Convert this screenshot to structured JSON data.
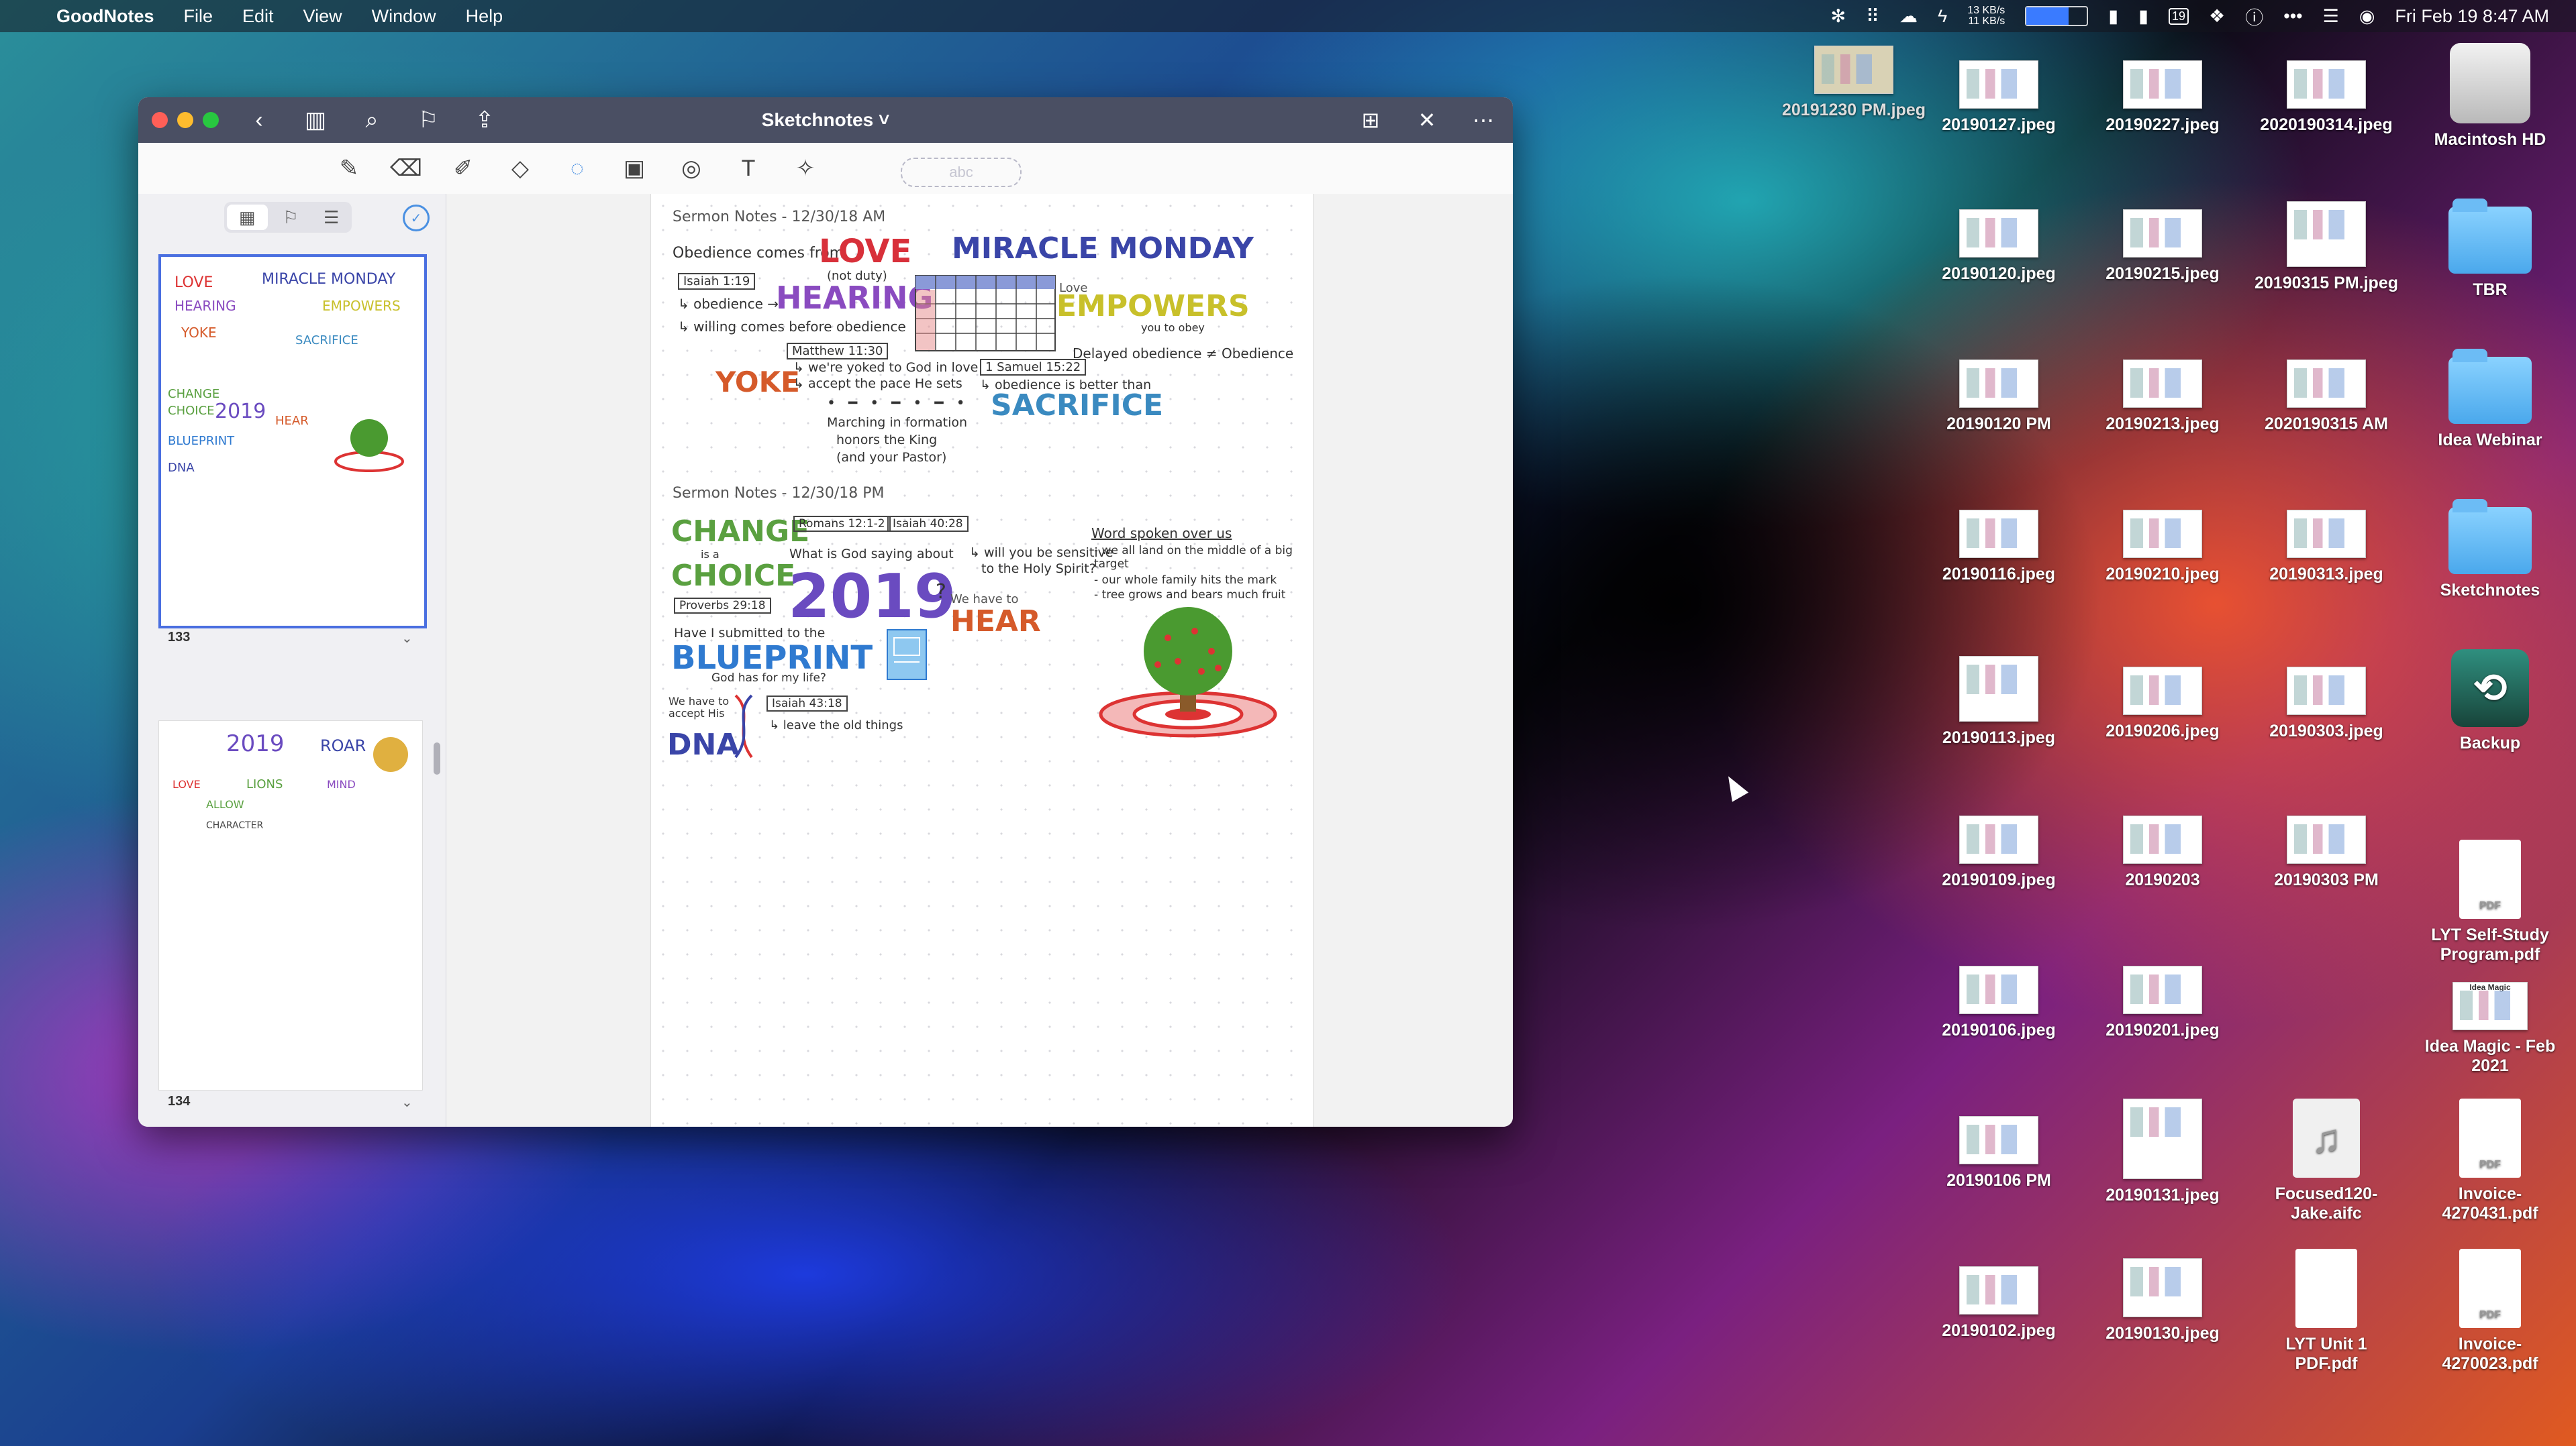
{
  "menubar": {
    "app_name": "GoodNotes",
    "menus": [
      "File",
      "Edit",
      "View",
      "Window",
      "Help"
    ],
    "net_up": "13 KB/s",
    "net_down": "11 KB/s",
    "calendar_day": "19",
    "datetime": "Fri Feb 19  8:47 AM"
  },
  "window": {
    "title": "Sketchnotes ˅",
    "toolbar_textbox_placeholder": "abc",
    "sidebar": {
      "pages": [
        {
          "number": "133"
        },
        {
          "number": "134"
        }
      ]
    },
    "page": {
      "section1": {
        "header": "Sermon Notes - 12/30/18 AM",
        "lines": [
          "Obedience comes from",
          "LOVE",
          "(not duty)",
          "Isaiah 1:19",
          "↳ obedience →",
          "HEARING",
          "↳ willing comes before obedience",
          "MIRACLE MONDAY",
          "Love",
          "EMPOWERS",
          "you to obey",
          "Delayed obedience ≠ Obedience",
          "Matthew 11:30",
          "YOKE",
          "↳ we're yoked to God in love",
          "↳ accept the pace He sets",
          "1 Samuel 15:22",
          "↳ obedience is better than",
          "SACRIFICE",
          "Marching in formation",
          "honors the King",
          "(and your Pastor)"
        ]
      },
      "section2": {
        "header": "Sermon Notes - 12/30/18 PM",
        "lines": [
          "CHANGE",
          "is a",
          "CHOICE",
          "Romans 12:1-2",
          "Isaiah 40:28",
          "What is God saying about",
          "2019",
          "?",
          "↳ will you be sensitive",
          "to the Holy Spirit?",
          "Proverbs 29:18",
          "We have to",
          "HEAR",
          "Have I submitted to the",
          "BLUEPRINT",
          "God has for my life?",
          "Isaiah 43:18",
          "We have to accept His",
          "DNA",
          "↳ leave the old things",
          "Word spoken over us",
          "- we all land on the middle of a big target",
          "- our whole family hits the mark",
          "- tree grows and bears much fruit"
        ]
      }
    }
  },
  "desktop": {
    "icons": [
      {
        "label": "20191230 PM.jpeg",
        "kind": "jpeg"
      },
      {
        "label": "20190127.jpeg",
        "kind": "jpeg"
      },
      {
        "label": "20190227.jpeg",
        "kind": "jpeg"
      },
      {
        "label": "2020190314.jpeg",
        "kind": "jpeg"
      },
      {
        "label": "Macintosh HD",
        "kind": "drive"
      },
      {
        "label": "20190120.jpeg",
        "kind": "jpeg"
      },
      {
        "label": "20190215.jpeg",
        "kind": "jpeg"
      },
      {
        "label": "20190315 PM.jpeg",
        "kind": "jpeg"
      },
      {
        "label": "TBR",
        "kind": "folder"
      },
      {
        "label": "20190120 PM",
        "kind": "jpeg"
      },
      {
        "label": "20190213.jpeg",
        "kind": "jpeg"
      },
      {
        "label": "2020190315 AM",
        "kind": "jpeg"
      },
      {
        "label": "Idea Webinar",
        "kind": "folder"
      },
      {
        "label": "20190116.jpeg",
        "kind": "jpeg"
      },
      {
        "label": "20190210.jpeg",
        "kind": "jpeg"
      },
      {
        "label": "20190313.jpeg",
        "kind": "jpeg"
      },
      {
        "label": "Sketchnotes",
        "kind": "folder"
      },
      {
        "label": "20190113.jpeg",
        "kind": "jpeg"
      },
      {
        "label": "20190206.jpeg",
        "kind": "jpeg"
      },
      {
        "label": "20190303.jpeg",
        "kind": "jpeg"
      },
      {
        "label": "Backup",
        "kind": "backup"
      },
      {
        "label": "20190109.jpeg",
        "kind": "jpeg"
      },
      {
        "label": "20190203",
        "kind": "jpeg"
      },
      {
        "label": "20190303 PM",
        "kind": "jpeg"
      },
      {
        "label": "LYT Self-Study Program.pdf",
        "kind": "pdf"
      },
      {
        "label": "20190106.jpeg",
        "kind": "jpeg"
      },
      {
        "label": "20190201.jpeg",
        "kind": "jpeg"
      },
      {
        "label": "Idea Magic - Feb 2021",
        "kind": "pdf"
      },
      {
        "label": "20190106 PM",
        "kind": "jpeg"
      },
      {
        "label": "20190131.jpeg",
        "kind": "jpeg"
      },
      {
        "label": "Focused120-Jake.aifc",
        "kind": "audio"
      },
      {
        "label": "Invoice-4270431.pdf",
        "kind": "pdf"
      },
      {
        "label": "20190102.jpeg",
        "kind": "jpeg"
      },
      {
        "label": "20190130.jpeg",
        "kind": "jpeg"
      },
      {
        "label": "LYT Unit 1 PDF.pdf",
        "kind": "pdf"
      },
      {
        "label": "Invoice-4270023.pdf",
        "kind": "pdf"
      }
    ],
    "pdf_badge": "PDF",
    "idea_magic_thumb_title": "Idea Magic"
  }
}
